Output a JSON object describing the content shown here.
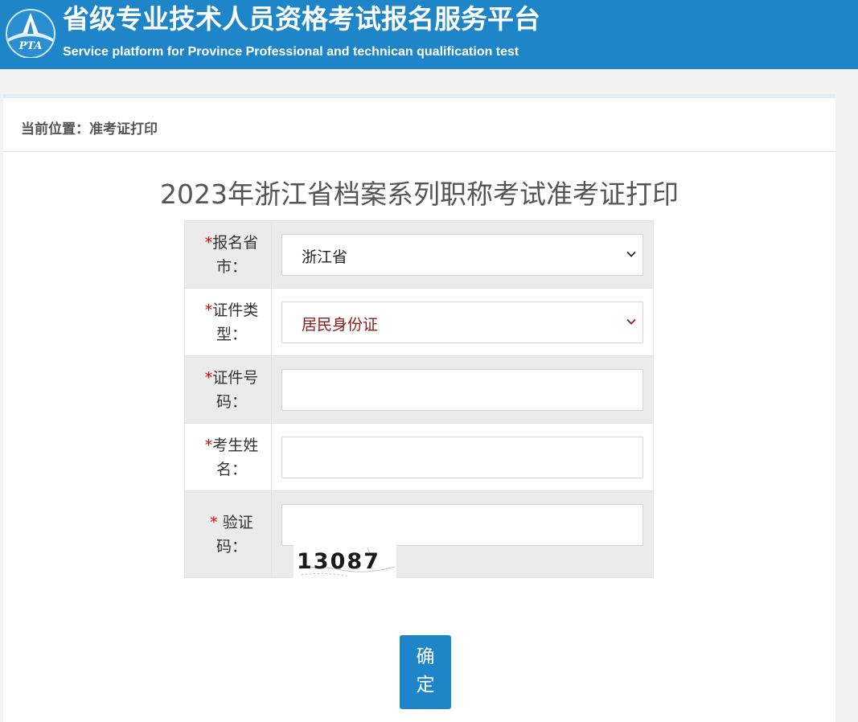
{
  "header": {
    "logo_text": "PTA",
    "title": "省级专业技术人员资格考试报名服务平台",
    "subtitle": "Service platform for Province Professional and technican qualification test"
  },
  "breadcrumb": "当前位置：准考证打印",
  "page_title": "2023年浙江省档案系列职称考试准考证打印",
  "form": {
    "required_mark": "*",
    "province": {
      "label": "报名省市：",
      "value": "浙江省"
    },
    "id_type": {
      "label": "证件类型：",
      "value": "居民身份证"
    },
    "id_number": {
      "label": "证件号码：",
      "value": "",
      "placeholder": ""
    },
    "name": {
      "label": "考生姓名：",
      "value": "",
      "placeholder": ""
    },
    "captcha": {
      "label": " 验证码：",
      "value": "",
      "placeholder": "",
      "image_text": "13087"
    }
  },
  "confirm_button": "确定",
  "colors": {
    "brand_blue": "#1e86c8",
    "required_red": "#e00000",
    "id_type_text": "#8b1a1a"
  }
}
